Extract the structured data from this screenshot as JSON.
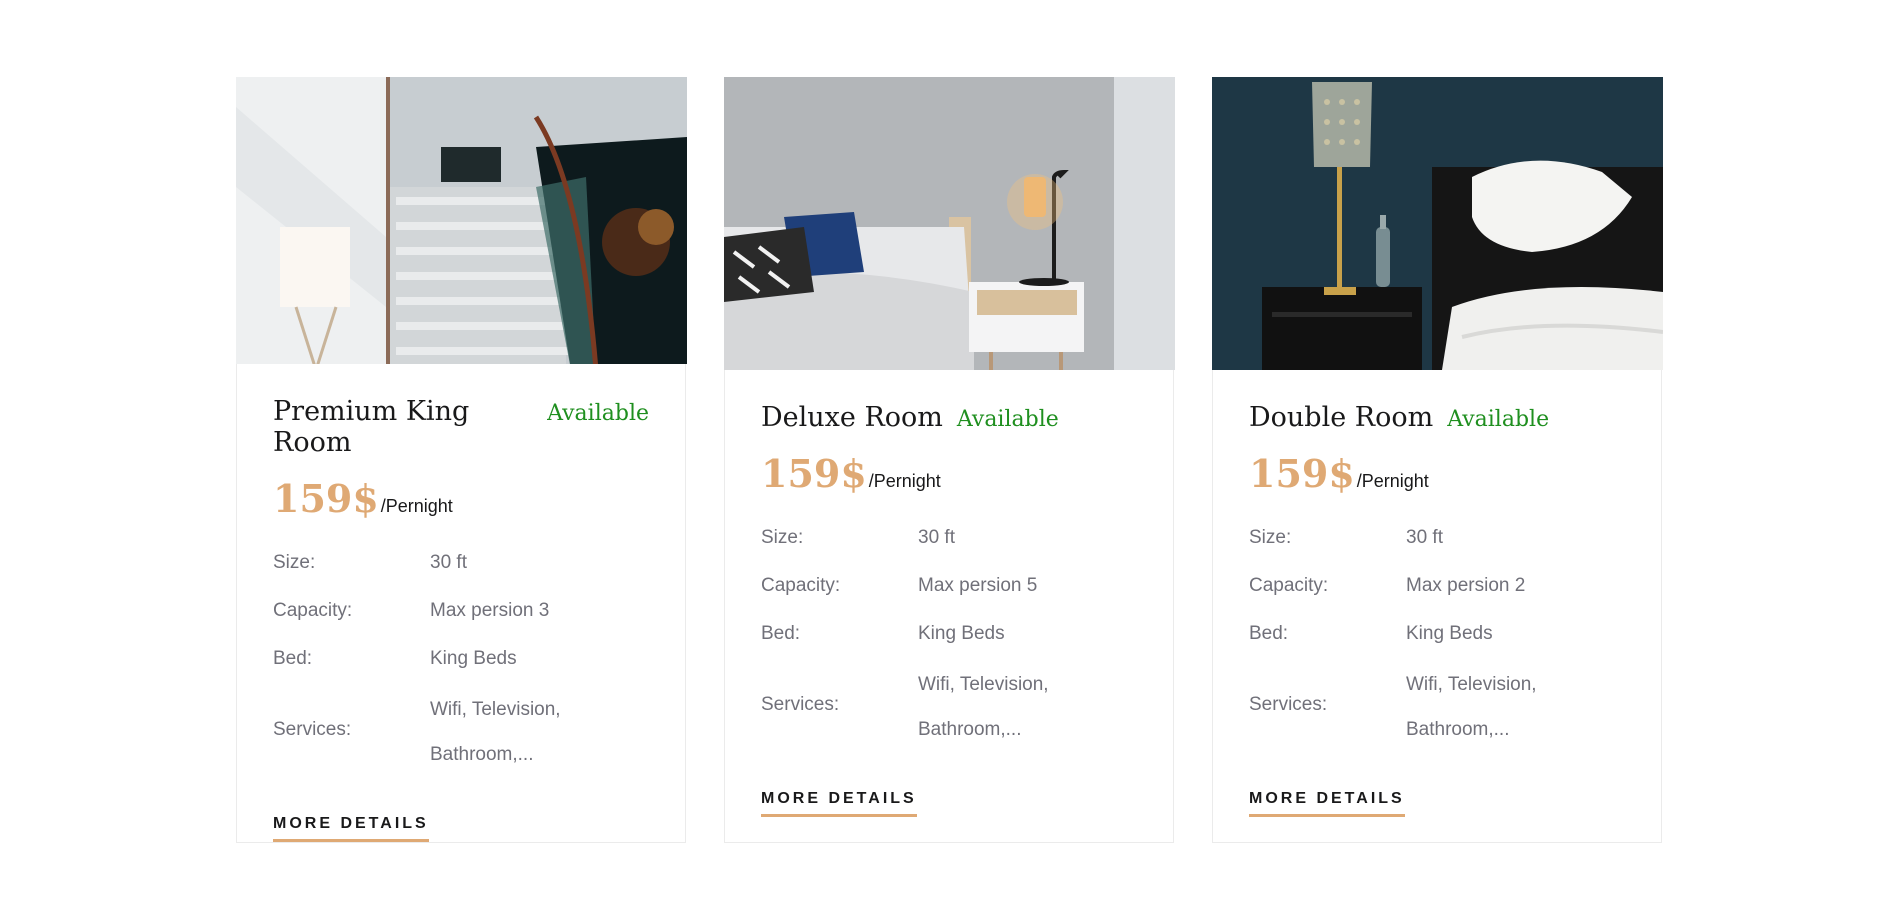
{
  "rooms": [
    {
      "name": "Premium King Room",
      "status": "Available",
      "price": "159$",
      "per": "/Pernight",
      "specs": {
        "size_label": "Size:",
        "size": "30 ft",
        "capacity_label": "Capacity:",
        "capacity": "Max persion 3",
        "bed_label": "Bed:",
        "bed": "King Beds",
        "services_label": "Services:",
        "services_line1": "Wifi, Television,",
        "services_line2": "Bathroom,..."
      },
      "link": "MORE DETAILS",
      "image": "staircase-lobby-photo"
    },
    {
      "name": "Deluxe Room",
      "status": "Available",
      "price": "159$",
      "per": "/Pernight",
      "specs": {
        "size_label": "Size:",
        "size": "30 ft",
        "capacity_label": "Capacity:",
        "capacity": "Max persion 5",
        "bed_label": "Bed:",
        "bed": "King Beds",
        "services_label": "Services:",
        "services_line1": "Wifi, Television,",
        "services_line2": "Bathroom,..."
      },
      "link": "MORE DETAILS",
      "image": "bedroom-lamp-photo"
    },
    {
      "name": "Double Room",
      "status": "Available",
      "price": "159$",
      "per": "/Pernight",
      "specs": {
        "size_label": "Size:",
        "size": "30 ft",
        "capacity_label": "Capacity:",
        "capacity": "Max persion 2",
        "bed_label": "Bed:",
        "bed": "King Beds",
        "services_label": "Services:",
        "services_line1": "Wifi, Television,",
        "services_line2": "Bathroom,..."
      },
      "link": "MORE DETAILS",
      "image": "dark-bedroom-photo"
    }
  ],
  "colors": {
    "accent": "#dfa974",
    "available": "#1f8f1f",
    "text_dark": "#19191a",
    "text_muted": "#707079",
    "border": "#ebebeb"
  }
}
